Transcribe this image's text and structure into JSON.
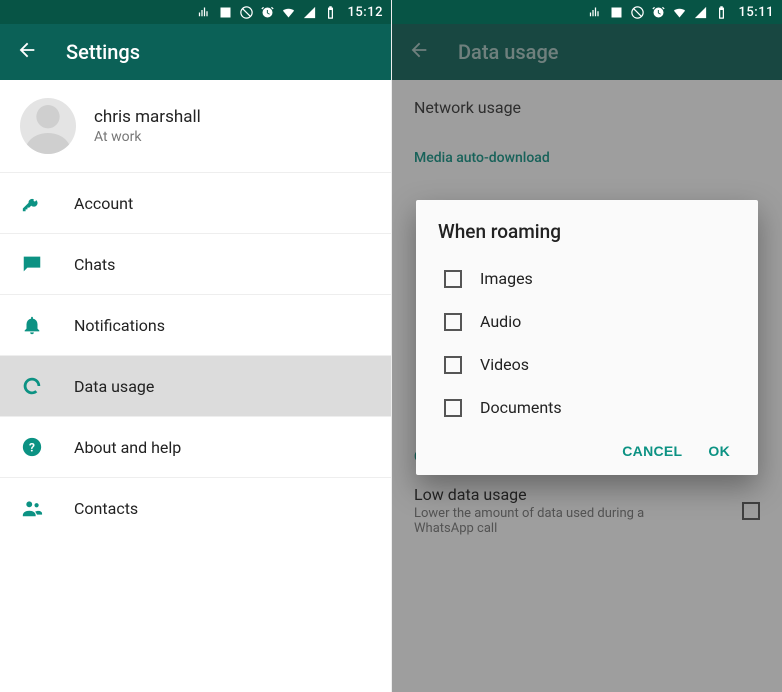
{
  "left": {
    "status": {
      "time": "15:12"
    },
    "appbar": {
      "title": "Settings"
    },
    "profile": {
      "name": "chris marshall",
      "status": "At work"
    },
    "items": [
      {
        "label": "Account"
      },
      {
        "label": "Chats"
      },
      {
        "label": "Notifications"
      },
      {
        "label": "Data usage"
      },
      {
        "label": "About and help"
      },
      {
        "label": "Contacts"
      }
    ]
  },
  "right": {
    "status": {
      "time": "15:11"
    },
    "appbar": {
      "title": "Data usage"
    },
    "rows": {
      "network_usage": "Network usage",
      "media_auto": "Media auto-download",
      "call_settings": "Call settings",
      "low_title": "Low data usage",
      "low_sub": "Lower the amount of data used during a WhatsApp call"
    },
    "dialog": {
      "title": "When roaming",
      "options": [
        {
          "label": "Images"
        },
        {
          "label": "Audio"
        },
        {
          "label": "Videos"
        },
        {
          "label": "Documents"
        }
      ],
      "cancel": "CANCEL",
      "ok": "OK"
    }
  },
  "colors": {
    "primary": "#0b6157",
    "accent": "#0c9283"
  }
}
